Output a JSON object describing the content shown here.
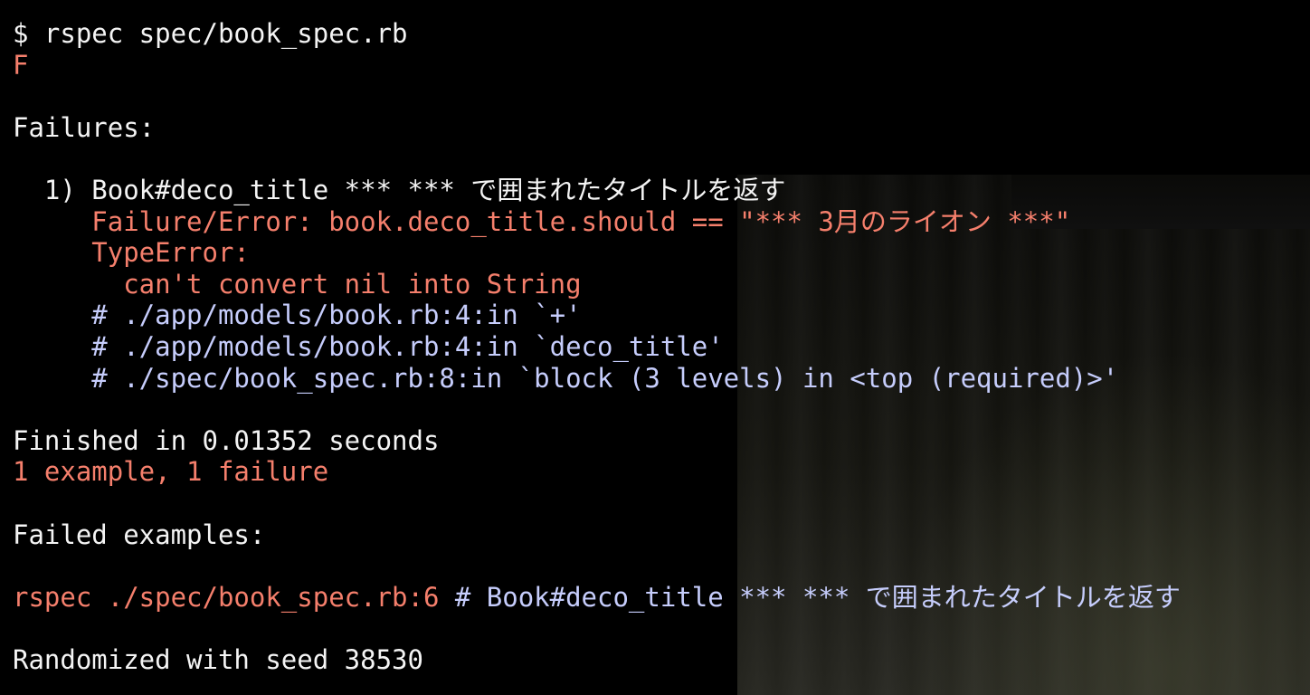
{
  "terminal": {
    "lines": [
      {
        "segments": [
          {
            "text": "$ rspec spec/book_spec.rb",
            "color": "white"
          }
        ]
      },
      {
        "segments": [
          {
            "text": "F",
            "color": "red"
          }
        ]
      },
      {
        "segments": [
          {
            "text": "",
            "color": "white"
          }
        ]
      },
      {
        "segments": [
          {
            "text": "Failures:",
            "color": "white"
          }
        ]
      },
      {
        "segments": [
          {
            "text": "",
            "color": "white"
          }
        ]
      },
      {
        "segments": [
          {
            "text": "  1) Book#deco_title *** *** で囲まれたタイトルを返す",
            "color": "white"
          }
        ]
      },
      {
        "segments": [
          {
            "text": "     Failure/Error: book.deco_title.should == \"*** 3月のライオン ***\"",
            "color": "red"
          }
        ]
      },
      {
        "segments": [
          {
            "text": "     TypeError:",
            "color": "red"
          }
        ]
      },
      {
        "segments": [
          {
            "text": "       can't convert nil into String",
            "color": "red"
          }
        ]
      },
      {
        "segments": [
          {
            "text": "     # ./app/models/book.rb:4:in `+'",
            "color": "blue"
          }
        ]
      },
      {
        "segments": [
          {
            "text": "     # ./app/models/book.rb:4:in `deco_title'",
            "color": "blue"
          }
        ]
      },
      {
        "segments": [
          {
            "text": "     # ./spec/book_spec.rb:8:in `block (3 levels) in <top (required)>'",
            "color": "blue"
          }
        ]
      },
      {
        "segments": [
          {
            "text": "",
            "color": "white"
          }
        ]
      },
      {
        "segments": [
          {
            "text": "Finished in 0.01352 seconds",
            "color": "white"
          }
        ]
      },
      {
        "segments": [
          {
            "text": "1 example, 1 failure",
            "color": "red"
          }
        ]
      },
      {
        "segments": [
          {
            "text": "",
            "color": "white"
          }
        ]
      },
      {
        "segments": [
          {
            "text": "Failed examples:",
            "color": "white"
          }
        ]
      },
      {
        "segments": [
          {
            "text": "",
            "color": "white"
          }
        ]
      },
      {
        "segments": [
          {
            "text": "rspec ./spec/book_spec.rb:6",
            "color": "red"
          },
          {
            "text": " # Book#deco_title *** *** で囲まれたタイトルを返す",
            "color": "blue"
          }
        ]
      },
      {
        "segments": [
          {
            "text": "",
            "color": "white"
          }
        ]
      },
      {
        "segments": [
          {
            "text": "Randomized with seed 38530",
            "color": "white"
          }
        ]
      }
    ]
  },
  "colors": {
    "background": "#000000",
    "default_text": "#f4f4f4",
    "failure_red": "#f57f6c",
    "backtrace_blue": "#c6cdfc"
  }
}
